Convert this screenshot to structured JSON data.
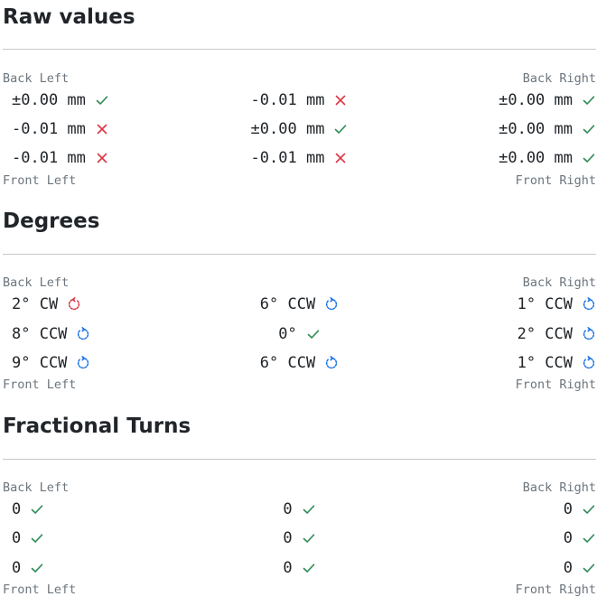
{
  "colors": {
    "ok": "#2e8b57",
    "bad": "#dc3545",
    "ccw": "#1a73e8",
    "cw": "#dc3545"
  },
  "sections": [
    {
      "title": "Raw values",
      "back_left": "Back Left",
      "back_right": "Back Right",
      "front_left": "Front Left",
      "front_right": "Front Right",
      "rows": [
        [
          {
            "value": "±0.00 mm",
            "icon": "check-icon"
          },
          {
            "value": "-0.01 mm",
            "icon": "cross-icon"
          },
          {
            "value": "±0.00 mm",
            "icon": "check-icon"
          }
        ],
        [
          {
            "value": "-0.01 mm",
            "icon": "cross-icon"
          },
          {
            "value": "±0.00 mm",
            "icon": "check-icon"
          },
          {
            "value": "±0.00 mm",
            "icon": "check-icon"
          }
        ],
        [
          {
            "value": "-0.01 mm",
            "icon": "cross-icon"
          },
          {
            "value": "-0.01 mm",
            "icon": "cross-icon"
          },
          {
            "value": "±0.00 mm",
            "icon": "check-icon"
          }
        ]
      ]
    },
    {
      "title": "Degrees",
      "back_left": "Back Left",
      "back_right": "Back Right",
      "front_left": "Front Left",
      "front_right": "Front Right",
      "rows": [
        [
          {
            "value": "2° CW",
            "icon": "rotate-cw-icon"
          },
          {
            "value": "6° CCW",
            "icon": "rotate-ccw-icon"
          },
          {
            "value": "1° CCW",
            "icon": "rotate-ccw-icon"
          }
        ],
        [
          {
            "value": "8° CCW",
            "icon": "rotate-ccw-icon"
          },
          {
            "value": "0°",
            "icon": "check-icon"
          },
          {
            "value": "2° CCW",
            "icon": "rotate-ccw-icon"
          }
        ],
        [
          {
            "value": "9° CCW",
            "icon": "rotate-ccw-icon"
          },
          {
            "value": "6° CCW",
            "icon": "rotate-ccw-icon"
          },
          {
            "value": "1° CCW",
            "icon": "rotate-ccw-icon"
          }
        ]
      ]
    },
    {
      "title": "Fractional Turns",
      "back_left": "Back Left",
      "back_right": "Back Right",
      "front_left": "Front Left",
      "front_right": "Front Right",
      "rows": [
        [
          {
            "value": "0",
            "icon": "check-icon"
          },
          {
            "value": "0",
            "icon": "check-icon"
          },
          {
            "value": "0",
            "icon": "check-icon"
          }
        ],
        [
          {
            "value": "0",
            "icon": "check-icon"
          },
          {
            "value": "0",
            "icon": "check-icon"
          },
          {
            "value": "0",
            "icon": "check-icon"
          }
        ],
        [
          {
            "value": "0",
            "icon": "check-icon"
          },
          {
            "value": "0",
            "icon": "check-icon"
          },
          {
            "value": "0",
            "icon": "check-icon"
          }
        ]
      ]
    }
  ]
}
